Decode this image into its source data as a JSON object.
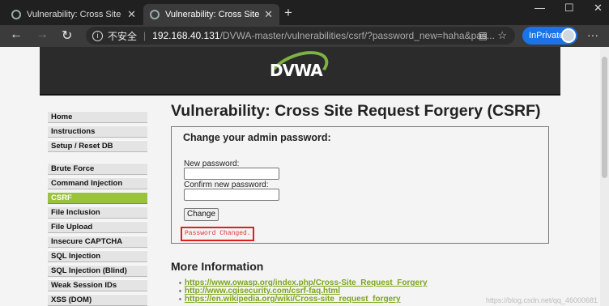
{
  "browser": {
    "tabs": [
      {
        "title": "Vulnerability: Cross Site Request",
        "active": false
      },
      {
        "title": "Vulnerability: Cross Site Request",
        "active": true
      }
    ],
    "new_tab_label": "+",
    "window_controls": {
      "minimize": "—",
      "maximize": "☐",
      "close": "✕"
    },
    "security_label": "不安全",
    "address_separator": "|",
    "url_host": "192.168.40.131",
    "url_path": "/DVWA-master/vulnerabilities/csrf/?password_new=haha&pas...",
    "inprivate_label": "InPrivate",
    "menu_label": "···"
  },
  "page": {
    "logo_text": "DVWA",
    "accent_color": "#9ac23c",
    "menu": {
      "group1": [
        "Home",
        "Instructions",
        "Setup / Reset DB"
      ],
      "group2": [
        "Brute Force",
        "Command Injection",
        "CSRF",
        "File Inclusion",
        "File Upload",
        "Insecure CAPTCHA",
        "SQL Injection",
        "SQL Injection (Blind)",
        "Weak Session IDs",
        "XSS (DOM)"
      ],
      "selected": "CSRF"
    },
    "title": "Vulnerability: Cross Site Request Forgery (CSRF)",
    "form": {
      "heading": "Change your admin password:",
      "new_password_label": "New password:",
      "confirm_password_label": "Confirm new password:",
      "button_label": "Change",
      "status_message": "Password Changed."
    },
    "more_info": {
      "heading": "More Information",
      "links": [
        "https://www.owasp.org/index.php/Cross-Site_Request_Forgery",
        "http://www.cgisecurity.com/csrf-faq.html",
        "https://en.wikipedia.org/wiki/Cross-site_request_forgery"
      ]
    },
    "watermark": "https://blog.csdn.net/qq_46000681"
  }
}
